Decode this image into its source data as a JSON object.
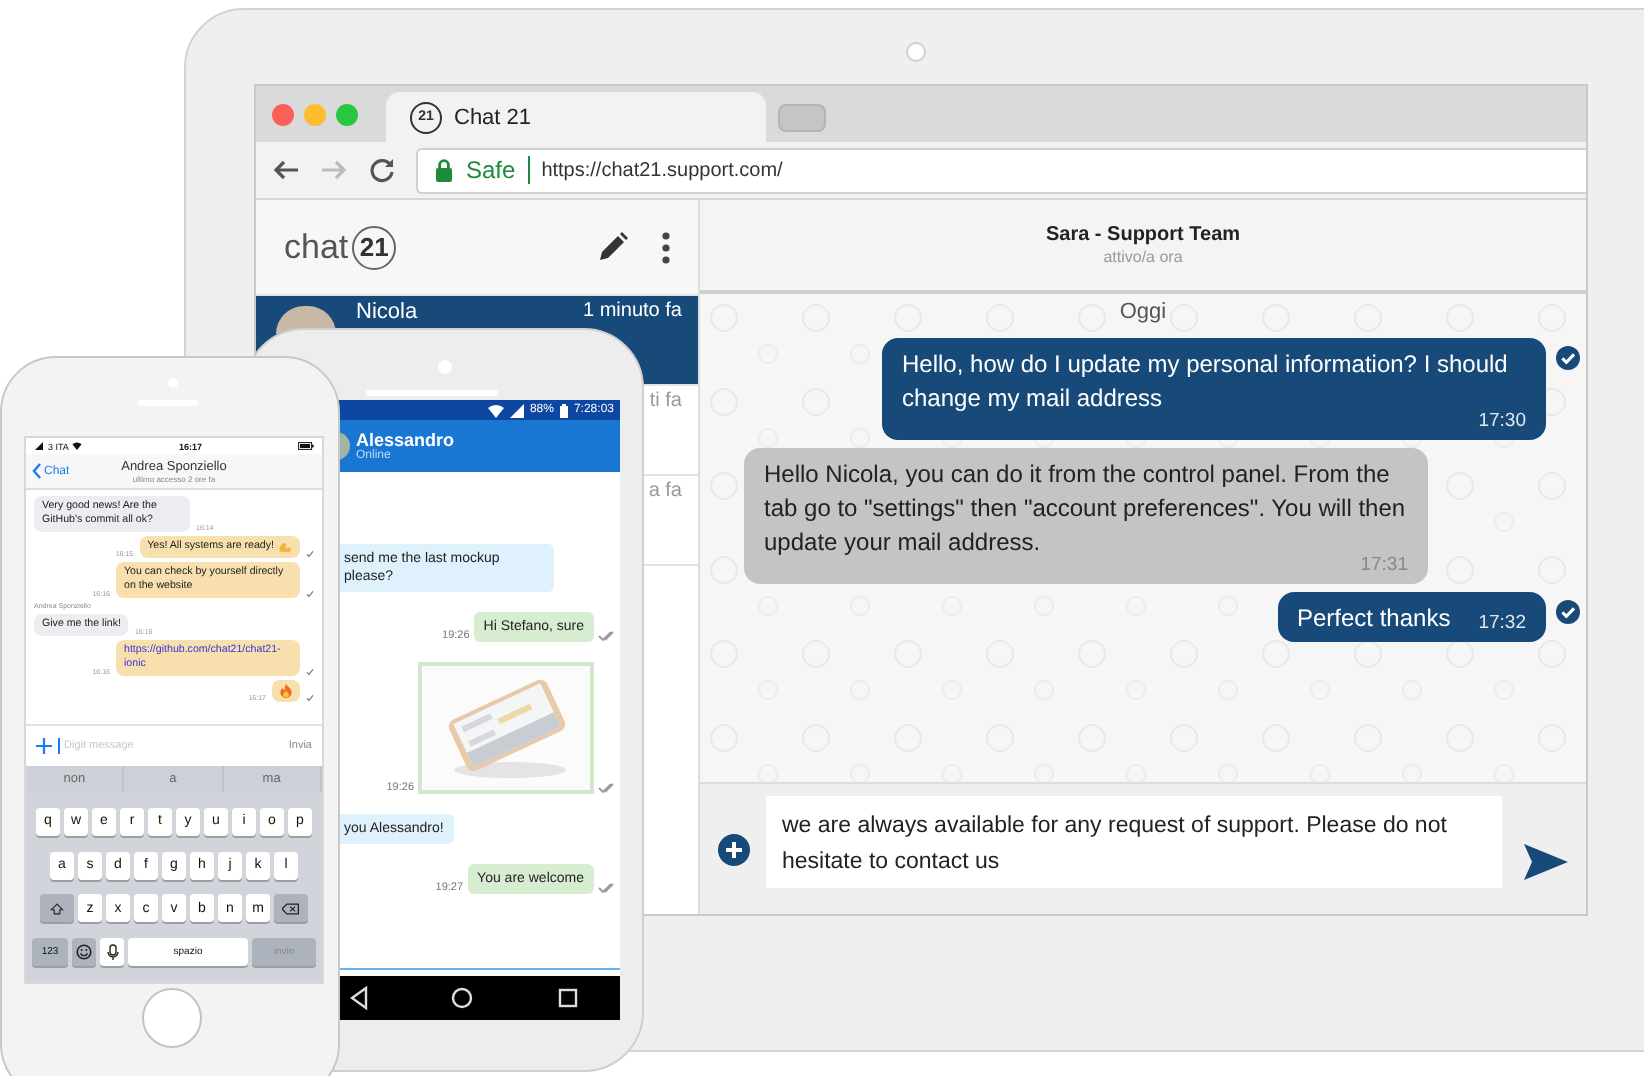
{
  "laptop": {
    "browser": {
      "tabs": [
        {
          "title": "Chat 21",
          "favicon_text": "21",
          "selected": true
        },
        {
          "selected": false
        }
      ],
      "address_bar": {
        "security_label": "Safe",
        "url": "https://chat21.support.com/"
      }
    },
    "sidebar": {
      "logo": {
        "word": "chat",
        "number": "21"
      },
      "conversations": [
        {
          "name": "Nicola",
          "time": "1 minuto fa",
          "selected": true
        },
        {
          "time": "ti fa",
          "selected": false
        },
        {
          "time": "a fa",
          "selected": false
        }
      ]
    },
    "conversation": {
      "title": "Sara - Support Team",
      "subtitle": "attivo/a ora",
      "day_label": "Oggi",
      "messages": [
        {
          "sent": true,
          "text": "Hello, how do I update my personal information? I should change my mail address",
          "time": "17:30",
          "read": true
        },
        {
          "sent": false,
          "text": "Hello Nicola, you can do it from the control panel. From the tab go to \"settings\" then \"account preferences\". You will then update your mail address.",
          "time": "17:31"
        },
        {
          "sent": true,
          "text": "Perfect thanks",
          "time": "17:32",
          "read": true
        }
      ],
      "composer": {
        "value": "we are always available for any request of support. Please do not hesitate to contact us"
      }
    }
  },
  "android": {
    "status_bar": {
      "battery": "88%",
      "time": "7:28:03"
    },
    "contact": {
      "name": "Alessandro",
      "status": "Online"
    },
    "messages": [
      {
        "sent": false,
        "kind": "text",
        "text": "send me the last mockup please?"
      },
      {
        "sent": true,
        "kind": "text",
        "text": "Hi Stefano, sure",
        "time": "19:26",
        "delivered": true
      },
      {
        "sent": true,
        "time": "19:26",
        "delivered": true
      },
      {
        "sent": false,
        "kind": "text",
        "text": "you Alessandro!"
      },
      {
        "sent": true,
        "kind": "text",
        "text": "You are welcome",
        "time": "19:27",
        "delivered": true
      }
    ]
  },
  "iphone": {
    "status_bar": {
      "carrier": "3 ITA",
      "time": "16:17"
    },
    "nav": {
      "back": "Chat",
      "title": "Andrea Sponziello",
      "subtitle": "ultimo accesso 2 ore fa"
    },
    "messages": [
      {
        "sent": false,
        "kind": "text",
        "text": "Very good news! Are the GitHub's commit all ok?",
        "time": "16:14"
      },
      {
        "sent": true,
        "kind": "emoji-text",
        "text": "Yes! All systems are ready!",
        "time": "16:15",
        "delivered": true
      },
      {
        "sent": true,
        "kind": "text",
        "text": "You can check by yourself directly on the website",
        "time": "16:16",
        "delivered": true
      },
      {
        "kind": "sender",
        "text": "Andrea Sponziello"
      },
      {
        "sent": false,
        "kind": "text",
        "text": "Give me the link!",
        "time": "16:16"
      },
      {
        "sent": true,
        "kind": "link",
        "text": "https://github.com/chat21/chat21-ionic",
        "time": "16:16",
        "delivered": true
      },
      {
        "sent": true,
        "kind": "emoji",
        "time": "16:17",
        "delivered": true
      }
    ],
    "input": {
      "placeholder": "Digit message",
      "send": "Invia"
    },
    "keyboard": {
      "suggestions": [
        "non",
        "a",
        "ma"
      ],
      "rows": [
        [
          "q",
          "w",
          "e",
          "r",
          "t",
          "y",
          "u",
          "i",
          "o",
          "p"
        ],
        [
          "a",
          "s",
          "d",
          "f",
          "g",
          "h",
          "j",
          "k",
          "l"
        ],
        [
          "z",
          "x",
          "c",
          "v",
          "b",
          "n",
          "m"
        ]
      ],
      "bottom": [
        {
          "kind": "numbers",
          "label": "123"
        },
        {
          "kind": "emoji"
        },
        {
          "kind": "mic"
        },
        {
          "kind": "space",
          "label": "spazio"
        },
        {
          "kind": "return",
          "label": "invio"
        }
      ]
    }
  }
}
